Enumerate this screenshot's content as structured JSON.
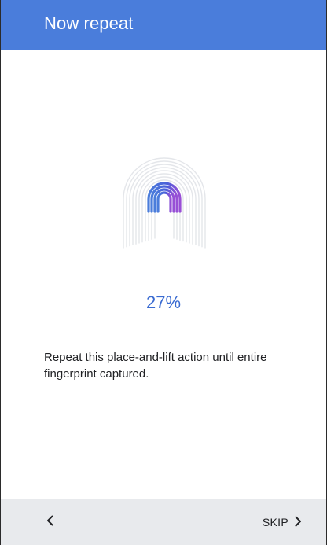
{
  "app_bar": {
    "title": "Now repeat",
    "color": "#4a7ddb"
  },
  "enrollment": {
    "progress_text": "27%",
    "progress_fraction": 0.27,
    "instruction": "Repeat this place-and-lift action until entire fingerprint captured.",
    "accent_color": "#3a6bd1",
    "icon": "fingerprint-icon"
  },
  "bottom_bar": {
    "back_icon": "chevron-left-icon",
    "skip_label": "SKIP",
    "skip_icon": "chevron-right-icon"
  }
}
